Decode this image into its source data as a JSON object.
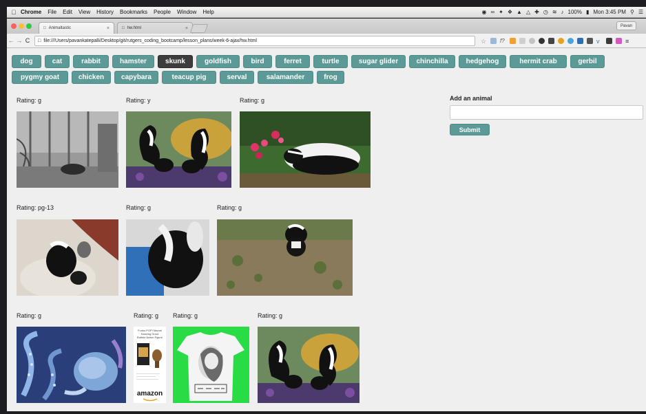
{
  "menubar": {
    "app": "Chrome",
    "items": [
      "File",
      "Edit",
      "View",
      "History",
      "Bookmarks",
      "People",
      "Window",
      "Help"
    ],
    "battery": "100%",
    "clock": "Mon 3:45 PM"
  },
  "browser": {
    "tabs": [
      {
        "title": "Animaltastic",
        "active": true
      },
      {
        "title": "hw.html",
        "active": false
      }
    ],
    "profile": "Pavan",
    "url": "file:///Users/pavankatepalli/Desktop/git/rutgers_coding_bootcamp/lesson_plans/week-6-ajax/hw.html"
  },
  "animal_buttons": [
    {
      "label": "dog"
    },
    {
      "label": "cat"
    },
    {
      "label": "rabbit"
    },
    {
      "label": "hamster"
    },
    {
      "label": "skunk",
      "active": true
    },
    {
      "label": "goldfish"
    },
    {
      "label": "bird"
    },
    {
      "label": "ferret"
    },
    {
      "label": "turtle"
    },
    {
      "label": "sugar glider"
    },
    {
      "label": "chinchilla"
    },
    {
      "label": "hedgehog"
    },
    {
      "label": "hermit crab"
    },
    {
      "label": "gerbil"
    },
    {
      "label": "pygmy goat"
    },
    {
      "label": "chicken"
    },
    {
      "label": "capybara"
    },
    {
      "label": "teacup pig"
    },
    {
      "label": "serval"
    },
    {
      "label": "salamander"
    },
    {
      "label": "frog"
    }
  ],
  "gifs": [
    {
      "rating": "Rating: g",
      "subject": "skunk-in-barn"
    },
    {
      "rating": "Rating: y",
      "subject": "cartoon-skunks"
    },
    {
      "rating": "Rating: g",
      "subject": "skunk-with-flowers"
    },
    {
      "rating": "Rating: pg-13",
      "subject": "baby-skunk"
    },
    {
      "rating": "Rating: g",
      "subject": "skunk-closeup"
    },
    {
      "rating": "Rating: g",
      "subject": "skunk-on-ground"
    },
    {
      "rating": "Rating: g",
      "subject": "octopus-art"
    },
    {
      "rating": "Rating: g",
      "subject": "funko-pop-amazon"
    },
    {
      "rating": "Rating: g",
      "subject": "mermaid-tshirt"
    },
    {
      "rating": "Rating: g",
      "subject": "cartoon-skunks-2"
    }
  ],
  "funko_card": {
    "lines": [
      "Funko POP! Marvel",
      "Dancing Groot",
      "Bobble Action Figure"
    ],
    "brand": "amazon"
  },
  "add_form": {
    "label": "Add an animal",
    "input_value": "",
    "submit_label": "Submit"
  },
  "colors": {
    "button_bg": "#5b9a96",
    "button_active_bg": "#3c3c3c",
    "page_bg": "#efefef"
  }
}
